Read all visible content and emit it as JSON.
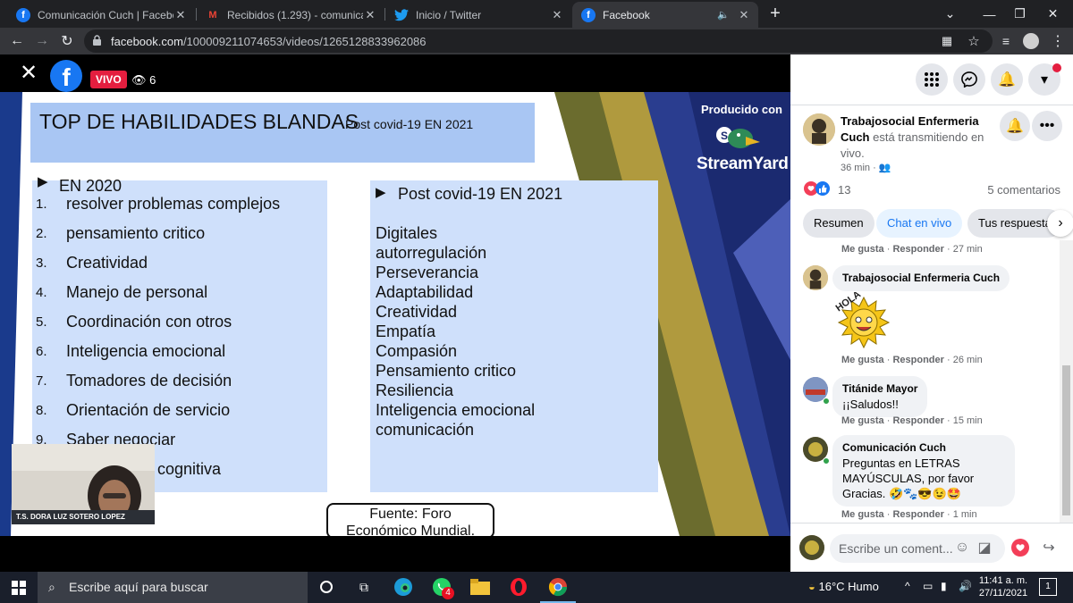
{
  "browser": {
    "tabs": [
      {
        "title": "Comunicación Cuch | Facebook",
        "icon": "facebook-icon",
        "active": false
      },
      {
        "title": "Recibidos (1.293) - comunicacion",
        "icon": "gmail-icon",
        "active": false
      },
      {
        "title": "Inicio / Twitter",
        "icon": "twitter-icon",
        "active": false
      },
      {
        "title": "Facebook",
        "icon": "facebook-icon",
        "active": true
      }
    ],
    "url_host": "facebook.com",
    "url_path": "/100009211074653/videos/1265128833962086"
  },
  "video": {
    "live_badge": "VIVO",
    "viewers": "6"
  },
  "slide": {
    "title": "TOP DE HABILIDADES BLANDAS",
    "title_sub": "Post covid-19 EN 2021",
    "left_header": "EN 2020",
    "left_items": [
      {
        "num": "1.",
        "text": "resolver problemas complejos"
      },
      {
        "num": "2.",
        "text": "pensamiento critico"
      },
      {
        "num": "3.",
        "text": "Creatividad"
      },
      {
        "num": "4.",
        "text": "Manejo de personal"
      },
      {
        "num": "5.",
        "text": "Coordinación con otros"
      },
      {
        "num": "6.",
        "text": "Inteligencia emocional"
      },
      {
        "num": "7.",
        "text": "Tomadores de decisión"
      },
      {
        "num": "8.",
        "text": "Orientación de servicio"
      },
      {
        "num": "9.",
        "text": "Saber negociar"
      },
      {
        "num": "",
        "text": "cognitiva"
      }
    ],
    "right_header": "Post covid-19 EN 2021",
    "right_items": [
      "Digitales",
      "autorregulación",
      "Perseverancia",
      "Adaptabilidad",
      "Creatividad",
      "Empatía",
      "Compasión",
      "Pensamiento critico",
      "Resiliencia",
      "Inteligencia emocional",
      "comunicación"
    ],
    "source_line1": "Fuente: Foro",
    "source_line2": "Económico Mundial.",
    "produced_by": "Producido con",
    "brand": "StreamYard",
    "webcam_name": "T.S. DORA LUZ SOTERO LOPEZ"
  },
  "panel": {
    "page_name": "Trabajosocial Enfermeria Cuch",
    "status": " está transmitiendo en vivo.",
    "time": "36 min ·",
    "reactions": "13",
    "comments_count": "5 comentarios",
    "tabs": [
      "Resumen",
      "Chat en vivo",
      "Tus respuesta"
    ],
    "comments": [
      {
        "meta_like": "Me gusta",
        "meta_reply": "Responder",
        "time": "27 min"
      },
      {
        "author": "Trabajosocial Enfermeria Cuch",
        "text": "",
        "sticker": "HOLA",
        "meta_like": "Me gusta",
        "meta_reply": "Responder",
        "time": "26 min"
      },
      {
        "author": "Titánide Mayor",
        "text": "¡¡Saludos!!",
        "meta_like": "Me gusta",
        "meta_reply": "Responder",
        "time": "15 min"
      },
      {
        "author": "Comunicación Cuch",
        "text": "Preguntas en LETRAS MAYÚSCULAS, por favor Gracias. 🤣🐾😎😉🤩",
        "meta_like": "Me gusta",
        "meta_reply": "Responder",
        "time": "1 min"
      }
    ],
    "composer_placeholder": "Escribe un coment..."
  },
  "taskbar": {
    "search_placeholder": "Escribe aquí para buscar",
    "whatsapp_badge": "4",
    "weather": "16°C  Humo",
    "time": "11:41 a. m.",
    "date": "27/11/2021",
    "notif_count": "1"
  }
}
